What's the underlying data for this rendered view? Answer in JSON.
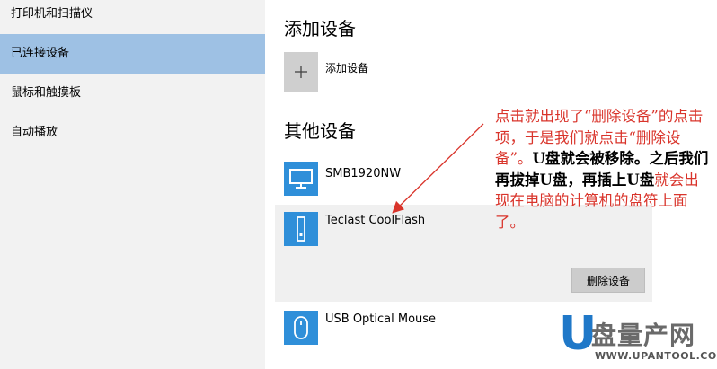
{
  "sidebar": {
    "items": [
      {
        "label": "打印机和扫描仪"
      },
      {
        "label": "已连接设备"
      },
      {
        "label": "鼠标和触摸板"
      },
      {
        "label": "自动播放"
      }
    ]
  },
  "main": {
    "add_section_title": "添加设备",
    "add_device_label": "添加设备",
    "other_section_title": "其他设备",
    "devices": [
      {
        "name": "SMB1920NW"
      },
      {
        "name": "Teclast CoolFlash"
      },
      {
        "name": "USB Optical Mouse"
      }
    ],
    "remove_button_label": "删除设备"
  },
  "annotation": {
    "part1": "点击就出现了“删除设备”的点击项，于是我们就点击“删除设备”。",
    "part2": "U盘就会被移除。之后我们再拔掉U盘，再插上U盘",
    "part3": "就会出现在电脑的计算机的盘符上面了。"
  },
  "watermark": {
    "letter": "U",
    "name": "盘量产网",
    "url": "WWW.UPANTOOL.COM"
  },
  "colors": {
    "accent": "#2f8fd9",
    "selected_nav": "#9ec1e4",
    "annotation_red": "#d9342b"
  }
}
